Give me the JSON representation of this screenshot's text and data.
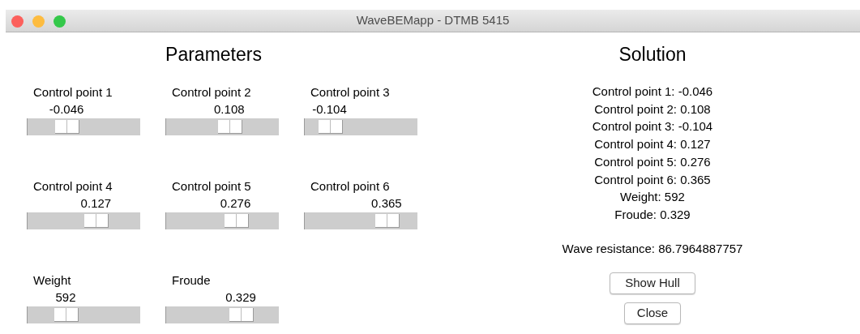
{
  "window": {
    "title": "WaveBEMapp - DTMB 5415"
  },
  "parameters": {
    "title": "Parameters",
    "sliders": [
      {
        "label": "Control point 1",
        "value": "-0.046",
        "level": 0.31
      },
      {
        "label": "Control point 2",
        "value": "0.108",
        "level": 0.58
      },
      {
        "label": "Control point 3",
        "value": "-0.104",
        "level": 0.15
      },
      {
        "label": "Control point 4",
        "value": "0.127",
        "level": 0.64
      },
      {
        "label": "Control point 5",
        "value": "0.276",
        "level": 0.65
      },
      {
        "label": "Control point 6",
        "value": "0.365",
        "level": 0.79
      },
      {
        "label": "Weight",
        "value": "592",
        "level": 0.3
      },
      {
        "label": "Froude",
        "value": "0.329",
        "level": 0.71
      }
    ]
  },
  "solution": {
    "title": "Solution",
    "lines": [
      "Control point 1: -0.046",
      "Control point 2: 0.108",
      "Control point 3: -0.104",
      "Control point 4: 0.127",
      "Control point 5: 0.276",
      "Control point 6: 0.365",
      "Weight: 592",
      "Froude: 0.329"
    ],
    "wave_resistance": "Wave resistance: 86.7964887757",
    "buttons": [
      "Show Hull",
      "Close"
    ]
  }
}
